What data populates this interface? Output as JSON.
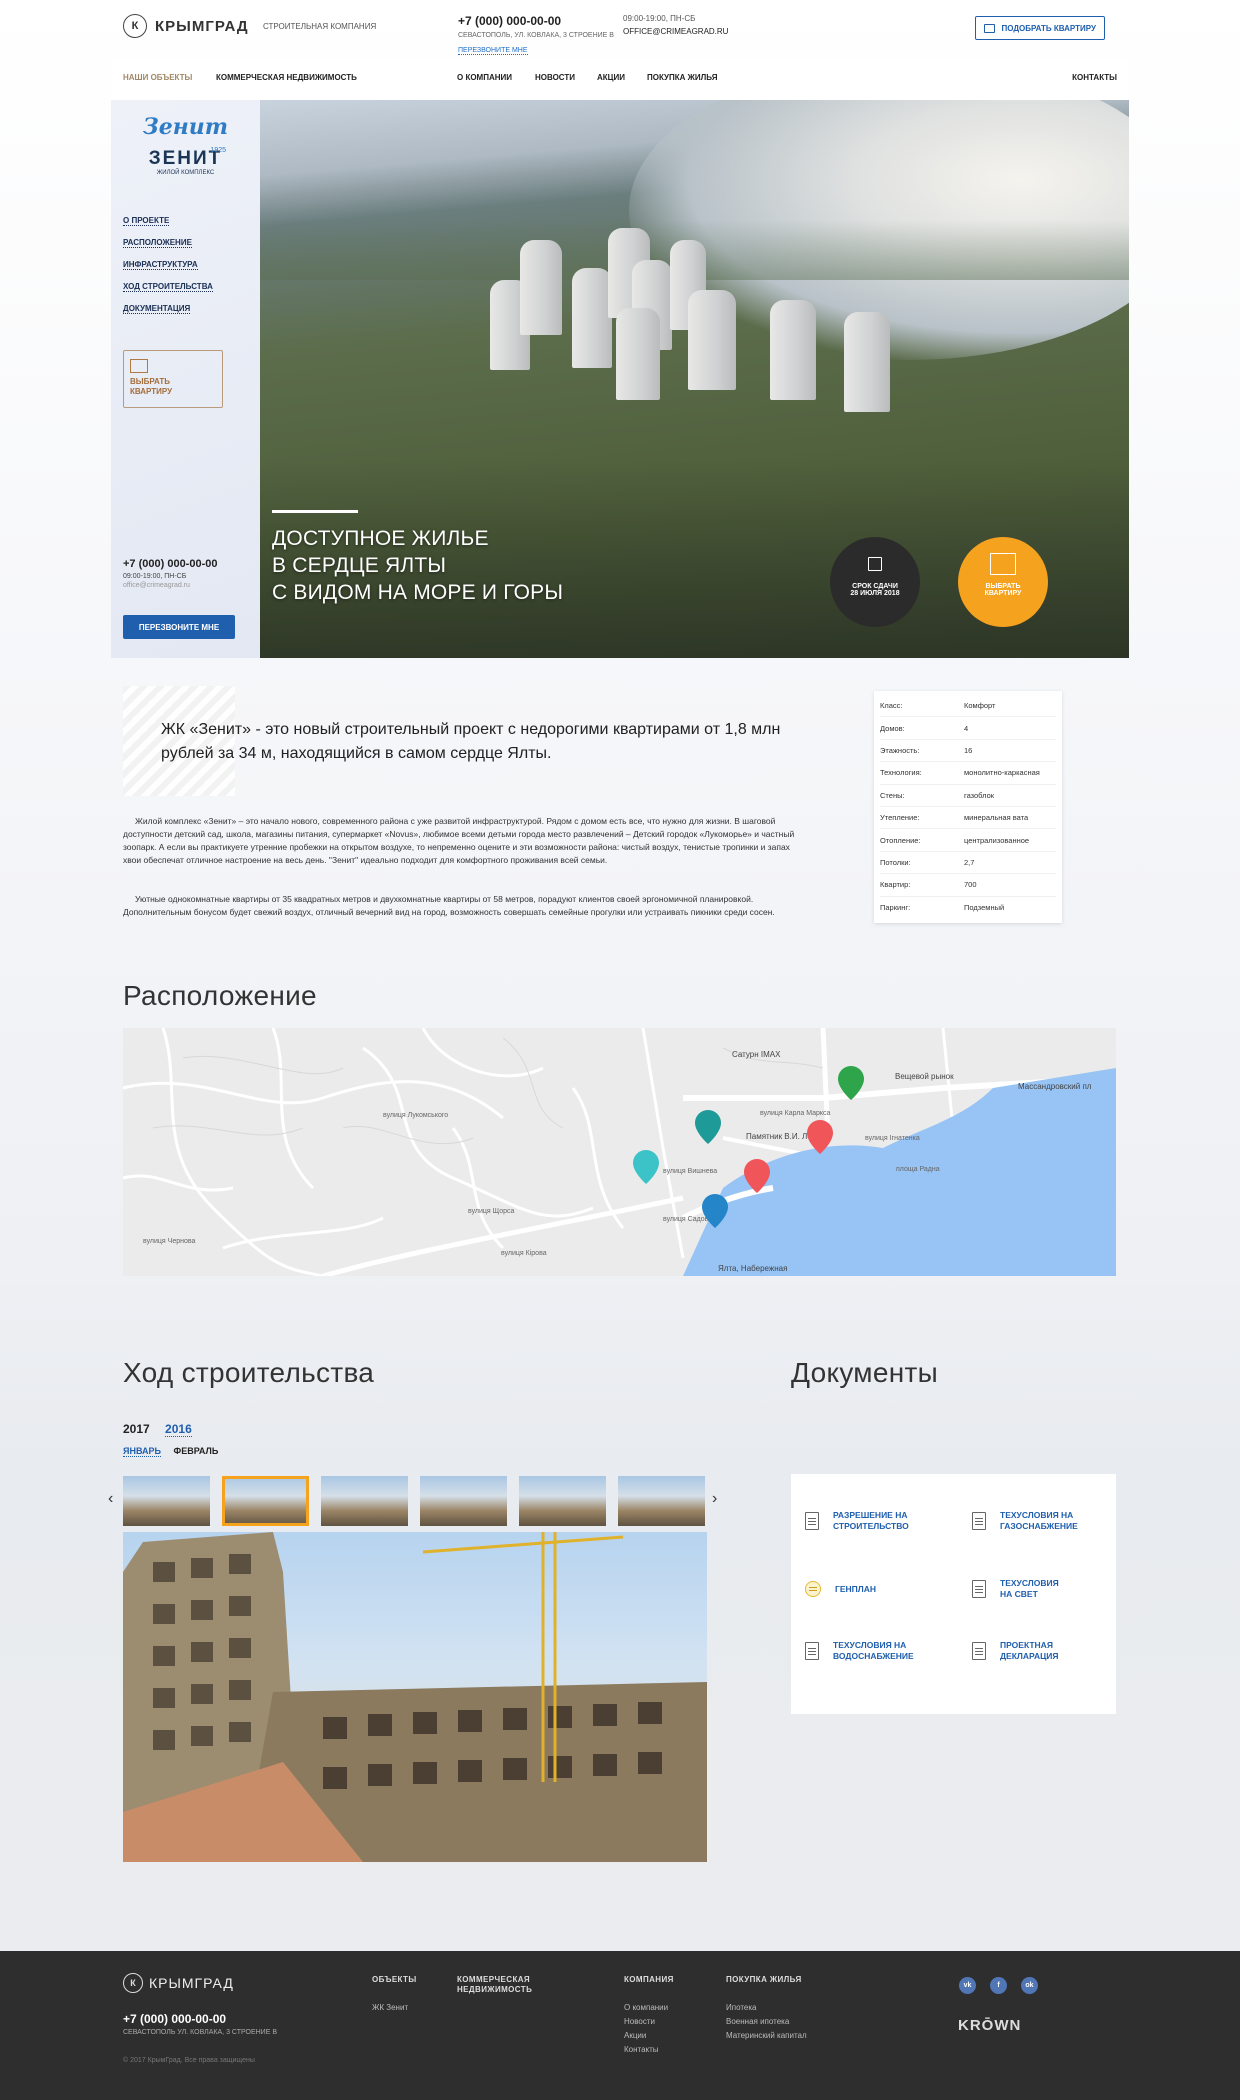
{
  "header": {
    "logo_text": "КРЫМГРАД",
    "logo_letter": "К",
    "tagline": "СТРОИТЕЛЬНАЯ КОМПАНИЯ",
    "phone": "+7 (000) 000-00-00",
    "address": "СЕВАСТОПОЛЬ, УЛ. КОВЛАКА, 3 СТРОЕНИЕ В",
    "callback": "ПЕРЕЗВОНИТЕ МНЕ",
    "hours": "09:00-19:00, ПН-СБ",
    "email": "OFFICE@CRIMEAGRAD.RU",
    "pick_button": "ПОДОБРАТЬ КВАРТИРУ"
  },
  "nav": {
    "our_objects": "НАШИ ОБЪЕКТЫ",
    "commercial": "КОММЕРЧЕСКАЯ НЕДВИЖИМОСТЬ",
    "about": "О КОМПАНИИ",
    "news": "НОВОСТИ",
    "actions": "АКЦИИ",
    "buy": "ПОКУПКА ЖИЛЬЯ",
    "contacts": "КОНТАКТЫ"
  },
  "side": {
    "logo_script": "Зенит",
    "logo_year": "1925",
    "logo_name": "ЗЕНИТ",
    "logo_sub": "ЖИЛОЙ КОМПЛЕКС",
    "menu": [
      "О ПРОЕКТЕ",
      "РАСПОЛОЖЕНИЕ",
      "ИНФРАСТРУКТУРА",
      "ХОД СТРОИТЕЛЬСТВА",
      "ДОКУМЕНТАЦИЯ"
    ],
    "choose_line1": "ВЫБРАТЬ",
    "choose_line2": "КВАРТИРУ",
    "phone": "+7 (000) 000-00-00",
    "hours": "09:00-19:00, ПН-СБ",
    "email": "office@crimeagrad.ru",
    "call_button": "ПЕРЕЗВОНИТЕ МНЕ"
  },
  "hero": {
    "line1": "ДОСТУПНОЕ ЖИЛЬЕ",
    "line2": "В СЕРДЦЕ ЯЛТЫ",
    "line3": "С ВИДОМ НА МОРЕ И ГОРЫ",
    "deadline_label": "СРОК СДАЧИ",
    "deadline_date": "28 ИЮЛЯ 2018",
    "choose_line1": "ВЫБРАТЬ",
    "choose_line2": "КВАРТИРУ"
  },
  "about": {
    "lead": "ЖК «Зенит» - это новый строительный проект с недорогими квартирами от 1,8 млн рублей за 34 м, находящийся в самом сердце Ялты.",
    "p1": "Жилой комплекс «Зенит» – это начало нового, современного района с уже развитой инфраструктурой. Рядом с домом есть все, что нужно для жизни. В шаговой доступности детский сад, школа, магазины питания, супермаркет «Novus», любимое всеми детьми города место развлечений – Детский городок «Лукоморье» и частный зоопарк. А если вы практикуете утренние пробежки на открытом воздухе, то непременно оцените и эти возможности района: чистый воздух, тенистые тропинки и запах хвои обеспечат отличное настроение на весь день. \"Зенит\" идеально подходит для комфортного проживания всей семьи.",
    "p2": "Уютные однокомнатные квартиры от 35 квадратных метров и двухкомнатные квартиры от 58 метров, порадуют клиентов своей эргономичной планировкой. Дополнительным бонусом будет свежий воздух, отличный вечерний вид на город, возможность совершать семейные прогулки или устраивать пикники среди сосен."
  },
  "specs": [
    {
      "k": "Класс:",
      "v": "Комфорт"
    },
    {
      "k": "Домов:",
      "v": "4"
    },
    {
      "k": "Этажность:",
      "v": "16"
    },
    {
      "k": "Технология:",
      "v": "монолитно-каркасная"
    },
    {
      "k": "Стены:",
      "v": "газоблок"
    },
    {
      "k": "Утепление:",
      "v": "минеральная вата"
    },
    {
      "k": "Отопление:",
      "v": "централизованное"
    },
    {
      "k": "Потолки:",
      "v": "2,7"
    },
    {
      "k": "Квартир:",
      "v": "700"
    },
    {
      "k": "Паркинг:",
      "v": "Подземный"
    }
  ],
  "location": {
    "title": "Расположение",
    "labels": {
      "saturn": "Сатурн IMAX",
      "market": "Вещевой рынок",
      "massandra": "Массандровский пл",
      "monument": "Памятник В.И. Ле",
      "karl": "вулиця Карла Маркса",
      "ignatenko": "вулиця Ігнатенка",
      "ploshcha": "площа Радна",
      "naberezhna": "Ялта, Набережная",
      "kirova": "вулиця Кірова",
      "lukomskogo": "вулиця Лукомського",
      "chernova": "вулиця Чернова",
      "sadova": "вулиця Садова",
      "vyshneva": "вулиця Вишнева",
      "shora": "вулиця Щорса"
    }
  },
  "construction": {
    "title": "Ход строительства",
    "years": [
      "2017",
      "2016"
    ],
    "months": [
      "ЯНВАРЬ",
      "ФЕВРАЛЬ"
    ],
    "prev": "‹",
    "next": "›"
  },
  "documents": {
    "title": "Документы",
    "items": [
      {
        "l1": "РАЗРЕШЕНИЕ НА",
        "l2": "СТРОИТЕЛЬСТВО"
      },
      {
        "l1": "ТЕХУСЛОВИЯ НА",
        "l2": "ГАЗОСНАБЖЕНИЕ"
      },
      {
        "l1": "ГЕНПЛАН",
        "l2": ""
      },
      {
        "l1": "ТЕХУСЛОВИЯ",
        "l2": "НА СВЕТ"
      },
      {
        "l1": "ТЕХУСЛОВИЯ НА",
        "l2": "ВОДОСНАБЖЕНИЕ"
      },
      {
        "l1": "ПРОЕКТНАЯ",
        "l2": "ДЕКЛАРАЦИЯ"
      }
    ]
  },
  "footer": {
    "logo_text": "КРЫМГРАД",
    "logo_letter": "К",
    "phone": "+7 (000) 000-00-00",
    "address": "СЕВАСТОПОЛЬ УЛ. КОВЛАКА, 3 СТРОЕНИЕ В",
    "copyright": "© 2017 КрымГрад. Все права защищены",
    "col_objects": "ОБЪЕКТЫ",
    "objects_item": "ЖК Зенит",
    "col_commercial_1": "КОММЕРЧЕСКАЯ",
    "col_commercial_2": "НЕДВИЖИМОСТЬ",
    "col_company": "КОМПАНИЯ",
    "company_items": [
      "О компании",
      "Новости",
      "Акции",
      "Контакты"
    ],
    "col_buy": "ПОКУПКА ЖИЛЬЯ",
    "buy_items": [
      "Ипотека",
      "Военная ипотека",
      "Материнский капитал"
    ],
    "social": [
      "vk",
      "f",
      "ok"
    ],
    "krown": "KRŌWN"
  },
  "colors": {
    "accent_blue": "#1f5fae",
    "orange": "#f5a21f",
    "footer_bg": "#2e2e2e"
  }
}
